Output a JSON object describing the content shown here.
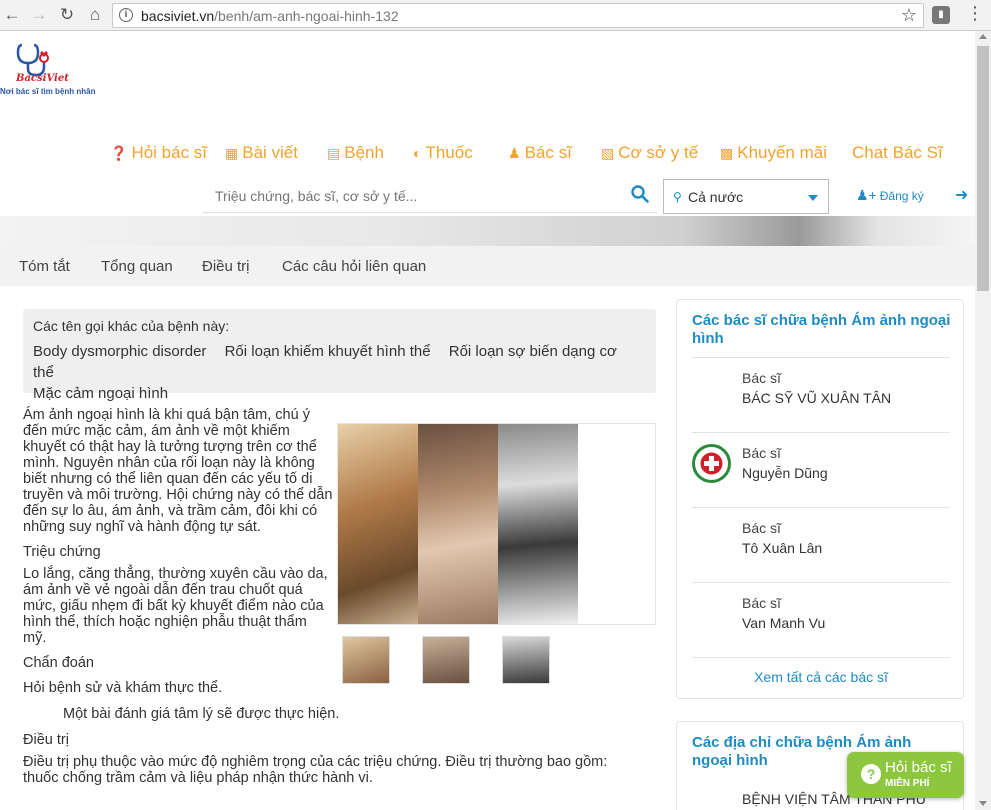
{
  "browser": {
    "url_domain": "bacsiviet.vn",
    "url_path": "/benh/am-anh-ngoai-hinh-132"
  },
  "site": {
    "brand": "BacsiViet",
    "tagline": "Nơi bác sĩ tìm bệnh nhân"
  },
  "nav": [
    {
      "label": "Hỏi bác sĩ",
      "icon": "question-circle-icon"
    },
    {
      "label": "Bài viết",
      "icon": "newspaper-icon"
    },
    {
      "label": "Bệnh",
      "icon": "bed-icon"
    },
    {
      "label": "Thuốc",
      "icon": "pill-icon"
    },
    {
      "label": "Bác sĩ",
      "icon": "doctor-icon"
    },
    {
      "label": "Cơ sở y tế",
      "icon": "clipboard-icon"
    },
    {
      "label": "Khuyến mãi",
      "icon": "gift-icon"
    },
    {
      "label": "Chat Bác Sĩ",
      "icon": ""
    }
  ],
  "search": {
    "placeholder": "Triệu chứng, bác sĩ, cơ sở y tế...",
    "location": "Cả nước"
  },
  "auth": {
    "register": "Đăng ký"
  },
  "tabs": [
    "Tóm tắt",
    "Tổng quan",
    "Điều trị",
    "Các câu hỏi liên quan"
  ],
  "alt_names": {
    "heading": "Các tên gọi khác của bệnh này:",
    "names": [
      "Body dysmorphic disorder",
      "Rối loạn khiếm khuyết hình thể",
      "Rối loạn sợ biến dạng cơ thể",
      "Mặc cảm ngoại hình"
    ]
  },
  "article": {
    "intro": "Ám ảnh ngoại hình là khi quá bận tâm, chú ý đến mức mặc cảm, ám ảnh về một khiếm khuyết có thật hay là tưởng tượng trên cơ thể mình. Nguyên nhân của rối loạn này là không biết nhưng có thể liên quan đến các yếu tố di truyền và môi trường. Hội chứng này có thể dẫn đến sự lo âu, ám ảnh, và trầm cảm, đôi khi có những suy nghĩ và hành động tự sát.",
    "symptoms_heading": "Triệu chứng",
    "symptoms": "Lo lắng, căng thẳng, thường xuyên cầu vào da, ám ảnh về vẻ ngoài dẫn đến trau chuốt quá mức, giấu nhẹm đi bất kỳ khuyết điểm nào của hình thể, thích hoặc nghiện phẫu thuật thẩm mỹ.",
    "diagnosis_heading": "Chẩn đoán",
    "diagnosis": "Hỏi bệnh sử và khám thực thể.",
    "diagnosis_extra": "Một bài đánh giá tâm lý sẽ được thực hiện.",
    "treatment_heading": "Điều trị",
    "treatment_1": "Điều trị phụ thuộc vào mức độ nghiêm trọng của các triệu chứng. Điều trị thường bao gồm:",
    "treatment_2": "thuốc chống trầm cảm và liệu pháp nhận thức hành vi."
  },
  "doctors": {
    "title": "Các bác sĩ chữa bệnh Ám ảnh ngoại hình",
    "items": [
      {
        "label": "Bác sĩ",
        "name": "BÁC SỸ VŨ XUÂN TÂN"
      },
      {
        "label": "Bác sĩ",
        "name": "Nguyễn Dũng"
      },
      {
        "label": "Bác sĩ",
        "name": "Tô Xuân Lân"
      },
      {
        "label": "Bác sĩ",
        "name": "Van Manh Vu"
      }
    ],
    "see_all": "Xem tất cả các bác sĩ"
  },
  "facilities": {
    "title": "Các địa chỉ chữa bệnh Ám ảnh ngoại hình",
    "first": "BỆNH VIỆN TÂM THẦN PHÚ"
  },
  "ask_button": {
    "line1": "Hỏi bác sĩ",
    "line2": "MIỄN PHÍ"
  },
  "colors": {
    "nav_orange": "#f0a330",
    "link_blue": "#1e8bc3",
    "ask_green": "#8dc63f"
  }
}
